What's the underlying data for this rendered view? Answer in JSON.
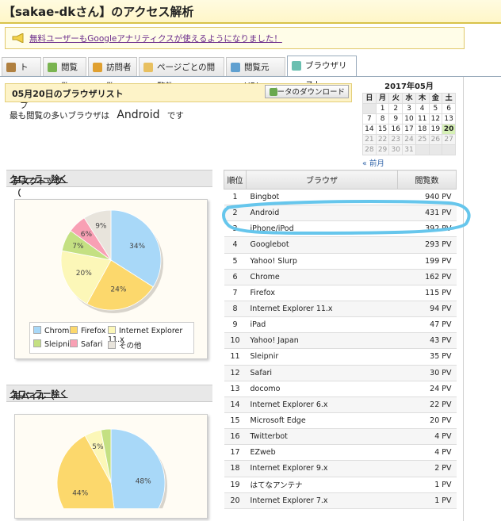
{
  "header": {
    "title": "【sakae-dkさん】のアクセス解析"
  },
  "notice": {
    "text": "無料ユーザーもGoogleアナリティクスが使えるようになりました！"
  },
  "tabs": [
    {
      "label": "トップ"
    },
    {
      "label": "閲覧数"
    },
    {
      "label": "訪問者数"
    },
    {
      "label": "ページごとの閲覧数"
    },
    {
      "label": "閲覧元URL"
    },
    {
      "label": "ブラウザリスト"
    }
  ],
  "date_header": {
    "title": "05月20日のブラウザリスト",
    "download": "データのダウンロード"
  },
  "summary": {
    "prefix": "最も閲覧の多いブラウザは",
    "browser": "Android",
    "suffix": "です"
  },
  "calendar": {
    "title": "2017年05月",
    "weekdays": [
      "日",
      "月",
      "火",
      "水",
      "木",
      "金",
      "土"
    ],
    "weeks": [
      [
        "",
        "1",
        "2",
        "3",
        "4",
        "5",
        "6"
      ],
      [
        "7",
        "8",
        "9",
        "10",
        "11",
        "12",
        "13"
      ],
      [
        "14",
        "15",
        "16",
        "17",
        "18",
        "19",
        "20"
      ],
      [
        "21",
        "22",
        "23",
        "24",
        "25",
        "26",
        "27"
      ],
      [
        "28",
        "29",
        "30",
        "31",
        "",
        "",
        ""
      ]
    ],
    "prev": "« 前月"
  },
  "desktop": {
    "heading_prefix": "デスクトップ（",
    "heading_link": "クローラー除く",
    "heading_suffix": "）"
  },
  "mobile": {
    "heading_prefix": "モバイル（",
    "heading_link": "クローラー除く",
    "heading_suffix": "）"
  },
  "chart_data": [
    {
      "type": "pie",
      "slices": [
        {
          "name": "Chrome",
          "value": 34,
          "label": "34%",
          "color": "#a8d8f8"
        },
        {
          "name": "Firefox",
          "value": 24,
          "label": "24%",
          "color": "#fcd86c"
        },
        {
          "name": "Internet Explorer 11.x",
          "value": 20,
          "label": "20%",
          "color": "#fcf7b8"
        },
        {
          "name": "Sleipnir",
          "value": 7,
          "label": "7%",
          "color": "#c4e082"
        },
        {
          "name": "Safari",
          "value": 6,
          "label": "6%",
          "color": "#f8a0b4"
        },
        {
          "name": "その他",
          "value": 9,
          "label": "9%",
          "color": "#e8e4dc"
        }
      ]
    },
    {
      "type": "pie",
      "slices": [
        {
          "name": "",
          "value": 48,
          "label": "48%",
          "color": "#a8d8f8"
        },
        {
          "name": "",
          "value": 44,
          "label": "44%",
          "color": "#fcd86c"
        },
        {
          "name": "",
          "value": 5,
          "label": "5%",
          "color": "#fcf7b8"
        },
        {
          "name": "",
          "value": 3,
          "label": "",
          "color": "#c4e082"
        }
      ]
    }
  ],
  "ranking": {
    "headers": [
      "順位",
      "ブラウザ",
      "閲覧数"
    ],
    "rows": [
      {
        "rank": "1",
        "name": "Bingbot",
        "pv": "940 PV"
      },
      {
        "rank": "2",
        "name": "Android",
        "pv": "431 PV"
      },
      {
        "rank": "3",
        "name": "iPhone/iPod",
        "pv": "392 PV"
      },
      {
        "rank": "4",
        "name": "Googlebot",
        "pv": "293 PV"
      },
      {
        "rank": "5",
        "name": "Yahoo! Slurp",
        "pv": "199 PV"
      },
      {
        "rank": "6",
        "name": "Chrome",
        "pv": "162 PV"
      },
      {
        "rank": "7",
        "name": "Firefox",
        "pv": "115 PV"
      },
      {
        "rank": "8",
        "name": "Internet Explorer 11.x",
        "pv": "94 PV"
      },
      {
        "rank": "9",
        "name": "iPad",
        "pv": "47 PV"
      },
      {
        "rank": "10",
        "name": "Yahoo! Japan",
        "pv": "43 PV"
      },
      {
        "rank": "11",
        "name": "Sleipnir",
        "pv": "35 PV"
      },
      {
        "rank": "12",
        "name": "Safari",
        "pv": "30 PV"
      },
      {
        "rank": "13",
        "name": "docomo",
        "pv": "24 PV"
      },
      {
        "rank": "14",
        "name": "Internet Explorer 6.x",
        "pv": "22 PV"
      },
      {
        "rank": "15",
        "name": "Microsoft Edge",
        "pv": "20 PV"
      },
      {
        "rank": "16",
        "name": "Twitterbot",
        "pv": "4 PV"
      },
      {
        "rank": "17",
        "name": "EZweb",
        "pv": "4 PV"
      },
      {
        "rank": "18",
        "name": "Internet Explorer 9.x",
        "pv": "2 PV"
      },
      {
        "rank": "19",
        "name": "はてなアンテナ",
        "pv": "1 PV"
      },
      {
        "rank": "20",
        "name": "Internet Explorer 7.x",
        "pv": "1 PV"
      }
    ]
  },
  "annotation_color": "#66c6ec"
}
